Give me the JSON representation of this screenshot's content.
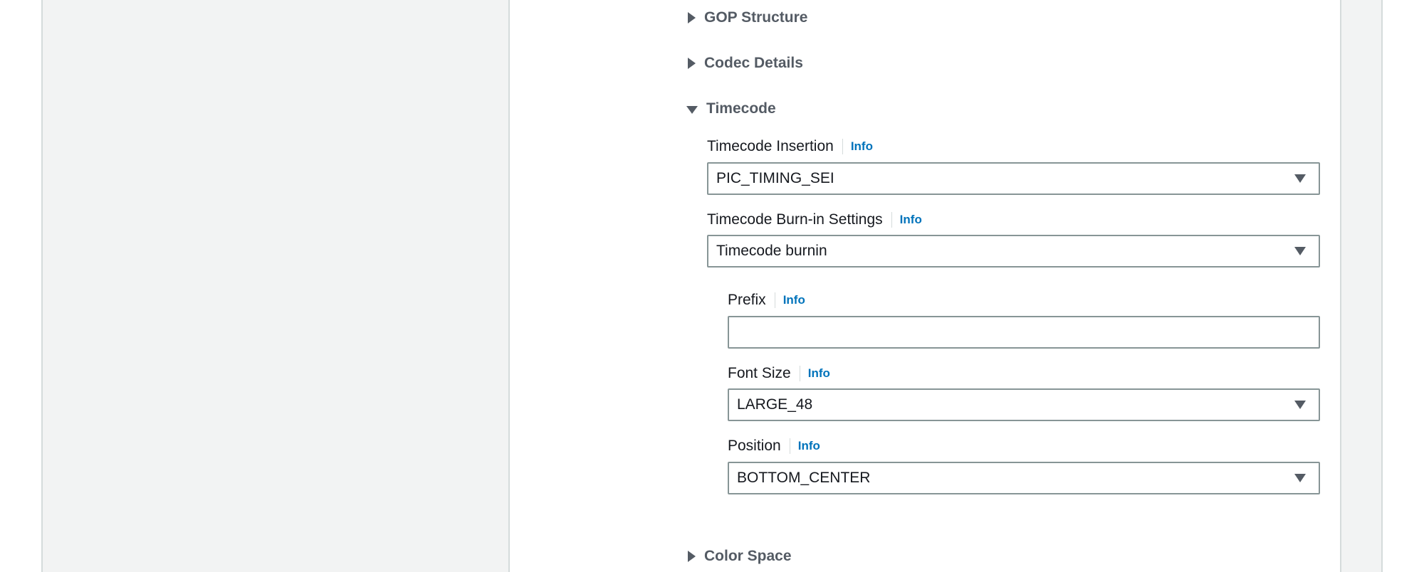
{
  "sections": {
    "gop_structure": "GOP Structure",
    "codec_details": "Codec Details",
    "timecode": "Timecode",
    "color_space": "Color Space"
  },
  "info_label": "Info",
  "timecode": {
    "insertion": {
      "label": "Timecode Insertion",
      "value": "PIC_TIMING_SEI"
    },
    "burnin_settings": {
      "label": "Timecode Burn-in Settings",
      "value": "Timecode burnin"
    },
    "prefix": {
      "label": "Prefix",
      "value": ""
    },
    "font_size": {
      "label": "Font Size",
      "value": "LARGE_48"
    },
    "position": {
      "label": "Position",
      "value": "BOTTOM_CENTER"
    }
  }
}
